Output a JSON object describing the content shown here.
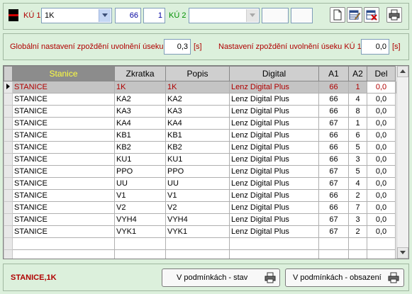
{
  "top": {
    "ku1_label": "KÚ 1",
    "ku1_value": "1K",
    "ku1_field_a": "66",
    "ku1_field_b": "1",
    "ku2_label": "KÚ 2",
    "ku2_value": "",
    "ku2_field_a": "",
    "ku2_field_b": ""
  },
  "delay": {
    "global_label": "Globální nastavení zpoždění uvolnění úseku",
    "global_value": "0,3",
    "global_unit": "[s]",
    "ku1_label": "Nastavení zpoždění uvolnění úseku KÚ 1",
    "ku1_value": "0,0",
    "ku1_unit": "[s]"
  },
  "grid": {
    "columns": [
      "Stanice",
      "Zkratka",
      "Popis",
      "Digital",
      "A1",
      "A2",
      "Del"
    ],
    "rows": [
      [
        "STANICE",
        "1K",
        "1K",
        "Lenz Digital Plus",
        "66",
        "1",
        "0,0"
      ],
      [
        "STANICE",
        "KA2",
        "KA2",
        "Lenz Digital Plus",
        "66",
        "4",
        "0,0"
      ],
      [
        "STANICE",
        "KA3",
        "KA3",
        "Lenz Digital Plus",
        "66",
        "8",
        "0,0"
      ],
      [
        "STANICE",
        "KA4",
        "KA4",
        "Lenz Digital Plus",
        "67",
        "1",
        "0,0"
      ],
      [
        "STANICE",
        "KB1",
        "KB1",
        "Lenz Digital Plus",
        "66",
        "6",
        "0,0"
      ],
      [
        "STANICE",
        "KB2",
        "KB2",
        "Lenz Digital Plus",
        "66",
        "5",
        "0,0"
      ],
      [
        "STANICE",
        "KU1",
        "KU1",
        "Lenz Digital Plus",
        "66",
        "3",
        "0,0"
      ],
      [
        "STANICE",
        "PPO",
        "PPO",
        "Lenz Digital Plus",
        "67",
        "5",
        "0,0"
      ],
      [
        "STANICE",
        "UU",
        "UU",
        "Lenz Digital Plus",
        "67",
        "4",
        "0,0"
      ],
      [
        "STANICE",
        "V1",
        "V1",
        "Lenz Digital Plus",
        "66",
        "2",
        "0,0"
      ],
      [
        "STANICE",
        "V2",
        "V2",
        "Lenz Digital Plus",
        "66",
        "7",
        "0,0"
      ],
      [
        "STANICE",
        "VYH4",
        "VYH4",
        "Lenz Digital Plus",
        "67",
        "3",
        "0,0"
      ],
      [
        "STANICE",
        "VYK1",
        "VYK1",
        "Lenz Digital Plus",
        "67",
        "2",
        "0,0"
      ]
    ]
  },
  "bottom": {
    "status": "STANICE,1K",
    "btn_stav": "V podmínkách - stav",
    "btn_obsazeni": "V podmínkách - obsazení"
  },
  "colors": {
    "background": "#dcf0dc",
    "selected_text": "#b00000",
    "header_selected": "#8c8c8c"
  }
}
